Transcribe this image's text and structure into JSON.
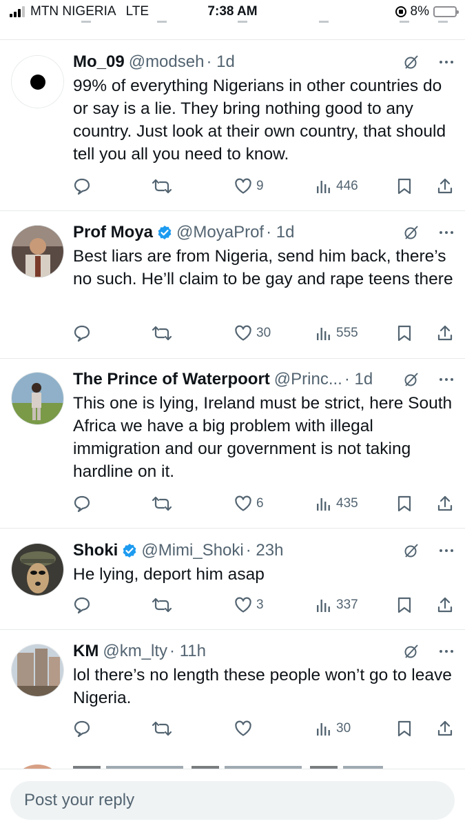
{
  "status_bar": {
    "carrier": "MTN NIGERIA",
    "network": "LTE",
    "time": "7:38 AM",
    "battery": "8%",
    "battery_level": 0.08,
    "battery_color": "#ff3b30"
  },
  "colors": {
    "text_primary": "#0f1419",
    "text_secondary": "#536471",
    "verified_blue": "#1d9bf0",
    "divider": "#e6e9ea"
  },
  "icons": {
    "grok": "grok-icon",
    "more": "more-icon",
    "reply": "reply-icon",
    "repost": "repost-icon",
    "like": "like-icon",
    "views": "views-icon",
    "bookmark": "bookmark-icon",
    "share": "share-icon",
    "verified": "verified-badge-icon"
  },
  "tweets": [
    {
      "name": "Mo_09",
      "handle": "@modseh",
      "time": "· 1d",
      "verified": false,
      "text": "99% of everything Nigerians in other countries do or say is a lie. They bring nothing good to any country. Just look at their own country, that should tell you all you need to know.",
      "likes": "9",
      "views": "446"
    },
    {
      "name": "Prof Moya",
      "handle": "@MoyaProf",
      "time": "· 1d",
      "verified": true,
      "text": "Best liars are from Nigeria, send him back, there’s no such. He’ll claim to be gay and rape teens there",
      "likes": "30",
      "views": "555"
    },
    {
      "name": "The Prince of Waterpoort",
      "handle": "@Princ...",
      "time": "· 1d",
      "verified": false,
      "text": "This one is lying, Ireland must be strict, here South Africa we have a big problem with illegal immigration and our government is not taking hardline on it.",
      "likes": "6",
      "views": "435"
    },
    {
      "name": "Shoki",
      "handle": "@Mimi_Shoki",
      "time": "· 23h",
      "verified": true,
      "text": "He lying, deport him asap",
      "likes": "3",
      "views": "337"
    },
    {
      "name": "KM",
      "handle": "@km_lty",
      "time": "· 11h",
      "verified": false,
      "text": "lol there’s no length these people won’t go to leave Nigeria.",
      "likes": "",
      "views": "30"
    }
  ],
  "reply": {
    "placeholder": "Post your reply"
  }
}
